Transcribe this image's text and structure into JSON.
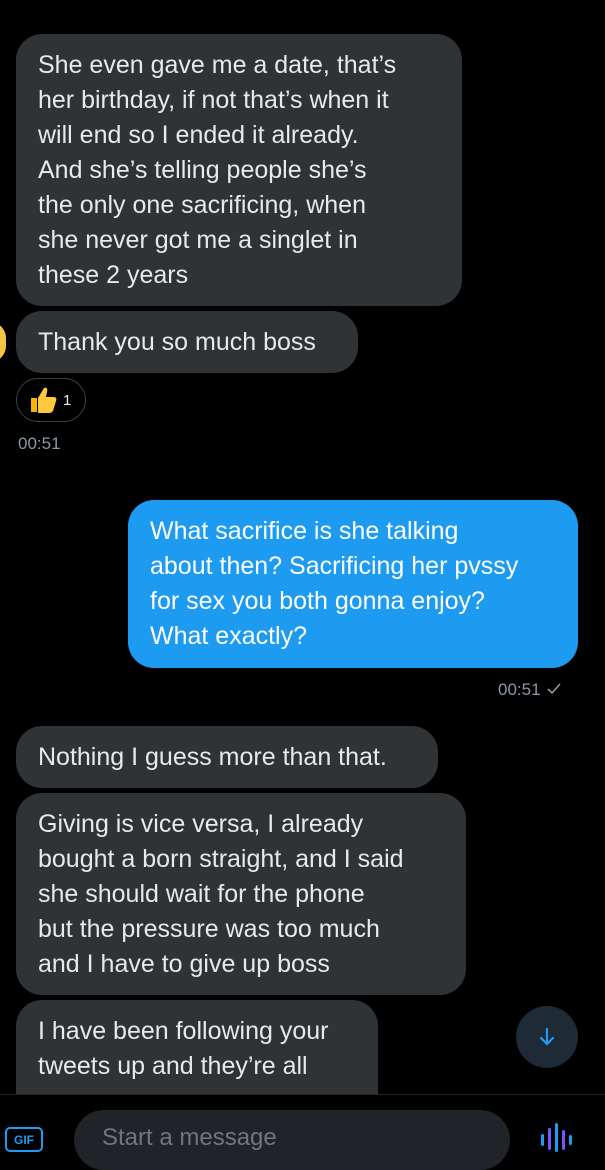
{
  "messages": {
    "received_1": "She even gave me a date, that’s\nher birthday, if not that’s when it\nwill end so I ended it already.\nAnd she’s telling people she’s\nthe only one sacrificing, when\nshe never got me a singlet in\nthese 2 years",
    "received_2": "Thank you so much boss",
    "reaction_count": "1",
    "received_time": "00:51",
    "sent_1": "What sacrifice is she talking\nabout then? Sacrificing her pvssy\nfor sex you both gonna enjoy?\nWhat exactly?",
    "sent_time": "00:51",
    "received_3": "Nothing I guess more than that.",
    "received_4": "Giving is vice versa, I already\nbought a born straight, and I said\nshe should wait for the phone\nbut the pressure was too much\nand I have to give up boss",
    "received_5": "I have been following your\ntweets up and they’re all"
  },
  "composer": {
    "gif_label": "GIF",
    "placeholder": "Start a message"
  },
  "colors": {
    "sent_bubble": "#1d9bf0",
    "received_bubble": "#2f3336",
    "background": "#000000"
  }
}
